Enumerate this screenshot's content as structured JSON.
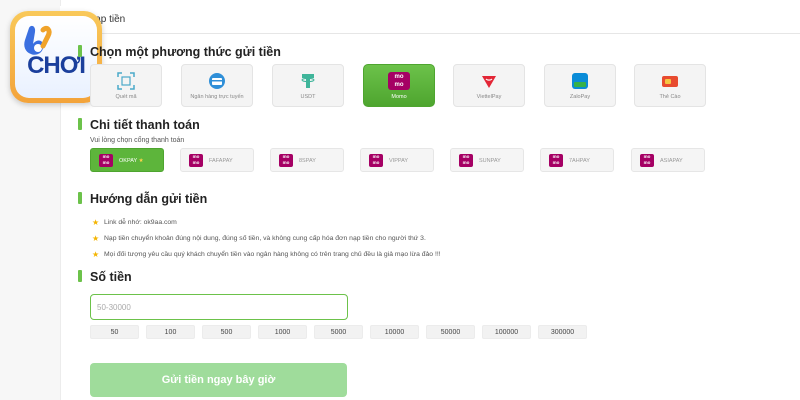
{
  "header": {
    "title": "Nạp tiền"
  },
  "logo": {
    "text": "CHƠI"
  },
  "methods_section": {
    "title": "Chọn một phương thức gửi tiền"
  },
  "methods": [
    {
      "label": "Quét mã",
      "icon": "qr-scan-icon"
    },
    {
      "label": "Ngân hàng trực tuyến",
      "icon": "bank-card-icon"
    },
    {
      "label": "USDT",
      "icon": "tether-icon"
    },
    {
      "label": "Momo",
      "icon": "momo-icon",
      "active": true
    },
    {
      "label": "ViettelPay",
      "icon": "viettelpay-icon"
    },
    {
      "label": "ZaloPay",
      "icon": "zalopay-icon"
    },
    {
      "label": "Thẻ Cào",
      "icon": "scratch-card-icon"
    }
  ],
  "payment_section": {
    "title": "Chi tiết thanh toán",
    "subtitle": "Vui lòng chọn cổng thanh toán"
  },
  "momo_logo": {
    "line1": "mo",
    "line2": "mo"
  },
  "gateways": [
    {
      "label": "OKPAY",
      "active": true,
      "badge": "★"
    },
    {
      "label": "FAFAPAY"
    },
    {
      "label": "8SPAY"
    },
    {
      "label": "VIPPAY"
    },
    {
      "label": "SUNPAY"
    },
    {
      "label": "7AHPAY"
    },
    {
      "label": "ASIAPAY"
    }
  ],
  "guide_section": {
    "title": "Hướng dẫn gửi tiền",
    "items": [
      "Link dễ nhớ: ok9aa.com",
      "Nạp tiền chuyển khoản đúng nội dung, đúng số tiền, và không cung cấp hóa đơn nạp tiền cho người thứ 3.",
      "Mọi đối tượng yêu cầu quý khách chuyển tiền vào ngân hàng không có trên trang chủ đều là giả mạo lừa đảo !!!"
    ]
  },
  "amount_section": {
    "title": "Số tiền",
    "placeholder": "50-30000"
  },
  "amount_chips": [
    "50",
    "100",
    "500",
    "1000",
    "5000",
    "10000",
    "50000",
    "100000",
    "300000"
  ],
  "submit": {
    "label": "Gửi tiền ngay bây giờ"
  },
  "colors": {
    "accent": "#6cc24a",
    "momo": "#a50064",
    "star": "#f4b400",
    "submit": "#9fdc9b"
  }
}
